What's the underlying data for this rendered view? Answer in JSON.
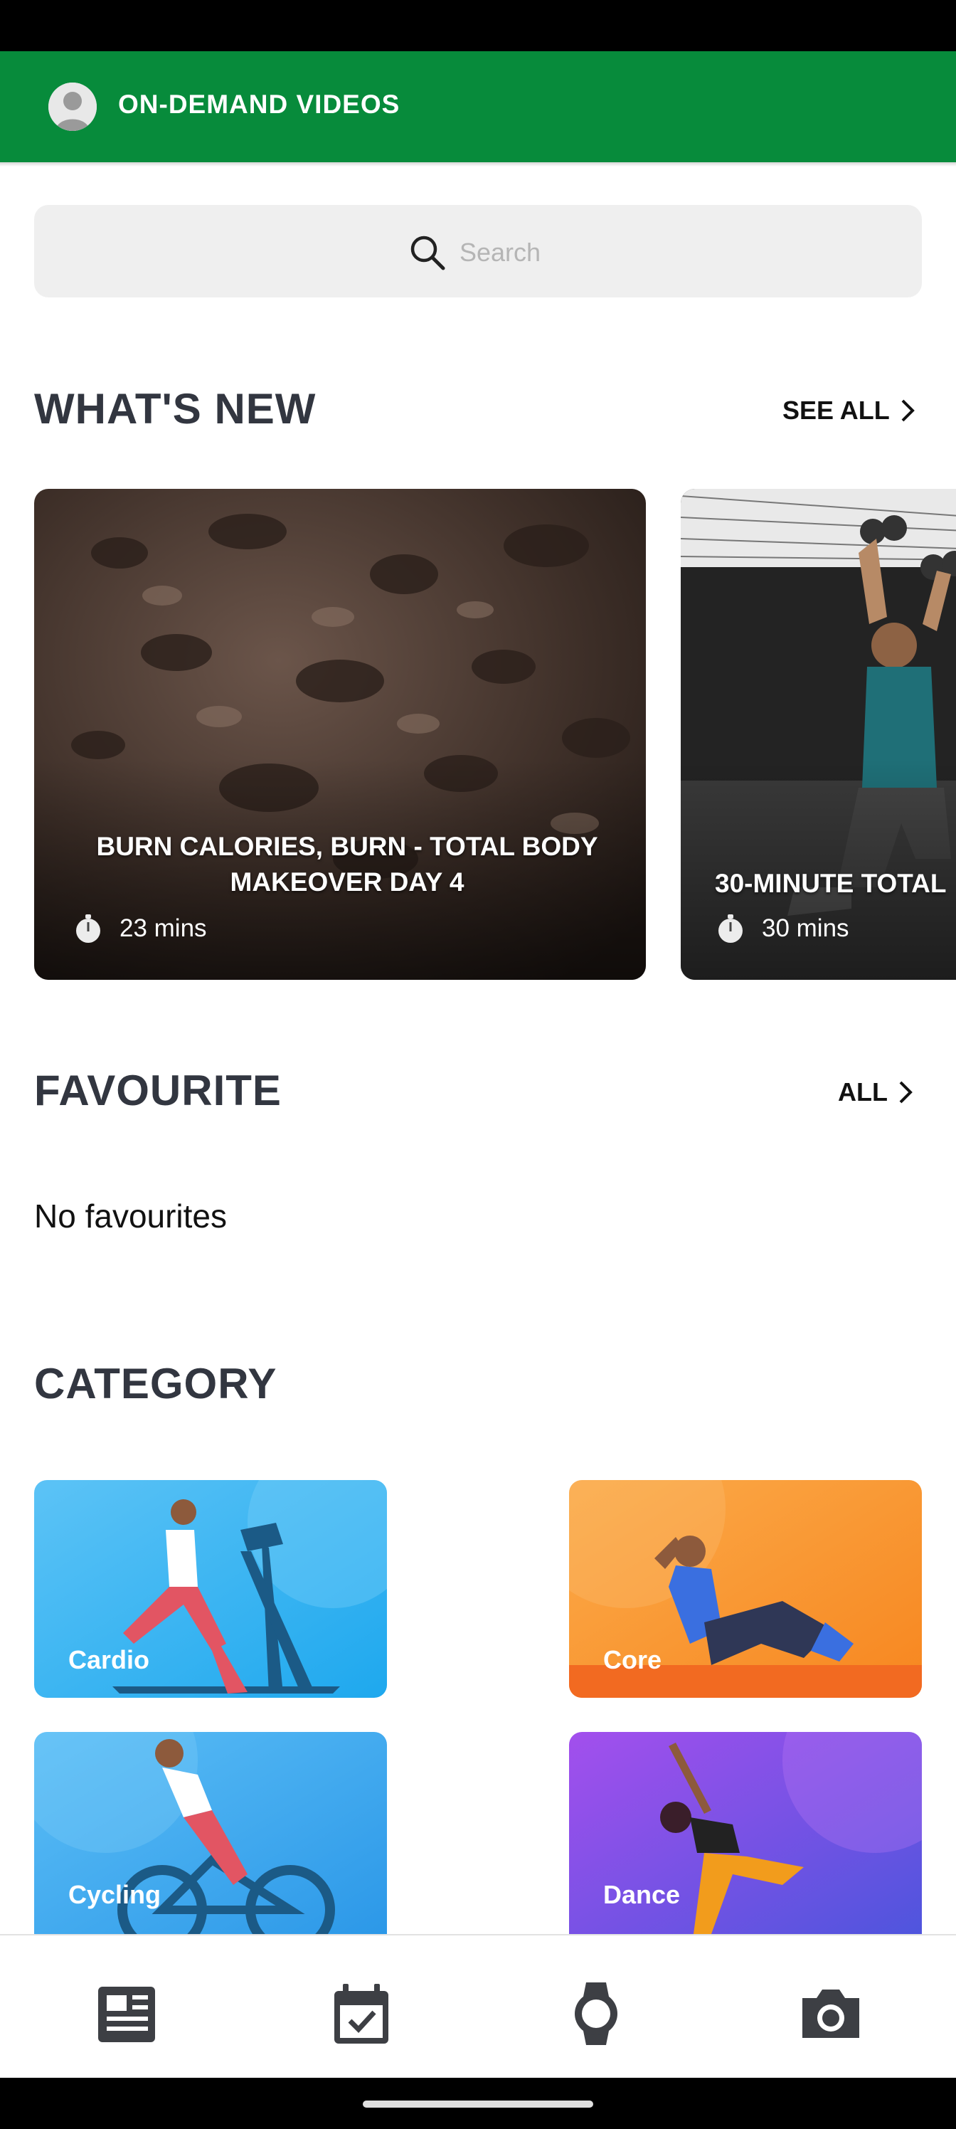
{
  "app_bar": {
    "title": "ON-DEMAND VIDEOS"
  },
  "search": {
    "placeholder": "Search"
  },
  "whats_new": {
    "title": "WHAT'S NEW",
    "see_all": "SEE ALL",
    "cards": [
      {
        "title": "BURN CALORIES, BURN - TOTAL BODY MAKEOVER DAY 4",
        "duration": "23 mins"
      },
      {
        "title": "30-MINUTE TOTAL",
        "duration": "30 mins"
      }
    ]
  },
  "favourite": {
    "title": "FAVOURITE",
    "all": "ALL",
    "empty_text": "No favourites"
  },
  "category": {
    "title": "CATEGORY",
    "items": [
      {
        "label": "Cardio",
        "color": "#36b0f0"
      },
      {
        "label": "Core",
        "color": "#f7922d"
      },
      {
        "label": "Cycling",
        "color": "#3aa5ec"
      },
      {
        "label": "Dance",
        "color": "#7d46e6"
      }
    ]
  },
  "bottom_nav": {
    "items": [
      {
        "icon": "news-icon"
      },
      {
        "icon": "calendar-check-icon"
      },
      {
        "icon": "watch-icon"
      },
      {
        "icon": "camera-icon"
      }
    ]
  },
  "colors": {
    "brand": "#078b3b",
    "heading": "#323640"
  }
}
